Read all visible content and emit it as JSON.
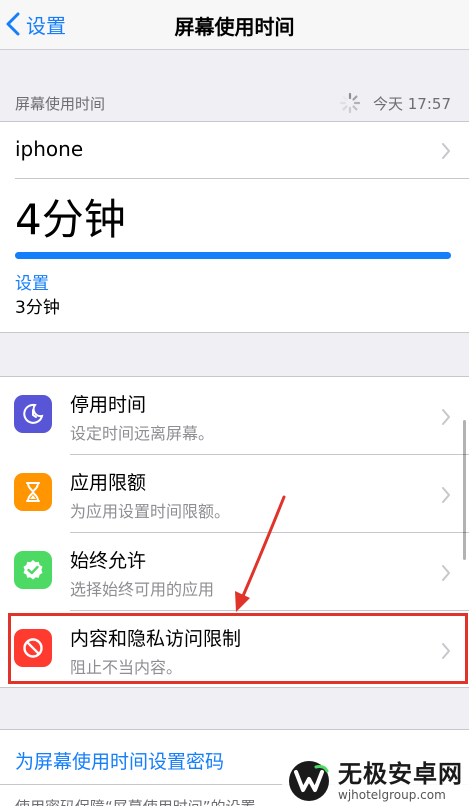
{
  "nav": {
    "back_label": "设置",
    "title": "屏幕使用时间"
  },
  "summary": {
    "section_label": "屏幕使用时间",
    "updated_text": "今天 17:57",
    "device_name": "iphone",
    "total_time": "4分钟",
    "usage_bar_fraction": 1.0,
    "category_label": "设置",
    "category_time": "3分钟"
  },
  "options": [
    {
      "title": "停用时间",
      "subtitle": "设定时间远离屏幕。",
      "icon": "downtime-icon",
      "color": "#5856d6"
    },
    {
      "title": "应用限额",
      "subtitle": "为应用设置时间限额。",
      "icon": "hourglass-icon",
      "color": "#ff9500"
    },
    {
      "title": "始终允许",
      "subtitle": "选择始终可用的应用",
      "icon": "checkmark-badge-icon",
      "color": "#4cd964"
    },
    {
      "title": "内容和隐私访问限制",
      "subtitle": "阻止不当内容。",
      "icon": "restriction-icon",
      "color": "#ff3b30"
    }
  ],
  "passcode": {
    "link_label": "为屏幕使用时间设置密码",
    "note": "使用密码保障“屏幕使用时间”的设置"
  },
  "watermark": {
    "name": "无极安卓网",
    "url": "wjhotelgroup.com"
  },
  "colors": {
    "accent": "#147efb",
    "highlight": "#e0332a"
  }
}
